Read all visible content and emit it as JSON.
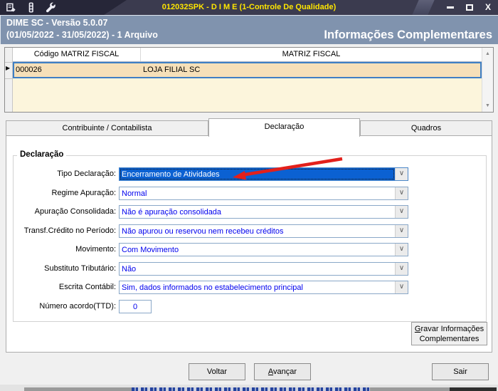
{
  "window": {
    "title": "012032SPK - D I M E (1-Controle De Qualidade)",
    "toolbar_icons": [
      "document-icon",
      "traffic-light-icon",
      "wrench-icon"
    ],
    "controls": {
      "minimize": "minimize",
      "maximize": "maximize",
      "close": "X"
    }
  },
  "header": {
    "version_line": "DIME SC - Versão 5.0.07",
    "period_line": "(01/05/2022 - 31/05/2022) - 1 Arquivo",
    "section_title": "Informações Complementares"
  },
  "grid": {
    "columns": [
      "Código MATRIZ FISCAL",
      "MATRIZ FISCAL"
    ],
    "rows": [
      [
        "000026",
        "LOJA FILIAL SC"
      ]
    ],
    "row_marker": "▶",
    "scroll_up": "▲",
    "scroll_down": "▼"
  },
  "tabs": [
    {
      "id": "contribuinte-contabilista",
      "label": "Contribuinte / Contabilista",
      "active": false
    },
    {
      "id": "declaracao",
      "label": "Declaração",
      "active": true
    },
    {
      "id": "quadros",
      "label": "Quadros",
      "active": false
    }
  ],
  "groupbox_title": "Declaração",
  "form": {
    "combo_chevron": "∨",
    "rows": [
      {
        "id": "tipo-declaracao",
        "label": "Tipo Declaração:",
        "value": "Encerramento de Atividades",
        "kind": "combo",
        "highlighted": true
      },
      {
        "id": "regime-apuracao",
        "label": "Regime Apuração:",
        "value": "Normal",
        "kind": "combo"
      },
      {
        "id": "apuracao-consolidada",
        "label": "Apuração Consolidada:",
        "value": "Não é apuração consolidada",
        "kind": "combo"
      },
      {
        "id": "transf-credito-periodo",
        "label": "Transf.Crédito no Período:",
        "value": "Não apurou ou reservou nem recebeu créditos",
        "kind": "combo"
      },
      {
        "id": "movimento",
        "label": "Movimento:",
        "value": "Com Movimento",
        "kind": "combo"
      },
      {
        "id": "substituto-tributario",
        "label": "Substituto Tributário:",
        "value": "Não",
        "kind": "combo"
      },
      {
        "id": "escrita-contabil",
        "label": "Escrita Contábil:",
        "value": "Sim, dados informados no estabelecimento principal",
        "kind": "combo"
      },
      {
        "id": "numero-acordo-ttd",
        "label": "Número acordo(TTD):",
        "value": "0",
        "kind": "input"
      }
    ]
  },
  "buttons": {
    "gravar": {
      "lines": [
        "Gravar Informações",
        "Complementares"
      ],
      "accel": "G"
    },
    "footer": [
      {
        "id": "voltar",
        "label": "Voltar"
      },
      {
        "id": "avancar",
        "label": "Avançar",
        "accel": "A"
      },
      {
        "id": "sair",
        "label": "Sair"
      }
    ]
  },
  "annotation": {
    "type": "arrow",
    "points_at": "tipo-declaracao-value",
    "color": "#E3201B"
  },
  "colors": {
    "titlebar_bg": "#3B3B4F",
    "titlebar_bg_dark": "#262638",
    "title_text": "#FFE600",
    "header_bg": "#8093AE",
    "header_text": "#FFFFFF",
    "body_bg": "#F0F0F0",
    "row_selected_bg": "#F6E0B9",
    "grid_empty_bg": "#FCF5DC",
    "selection_border": "#3F7FC4",
    "tab_border": "#ACACAC",
    "combo_text": "#0000EE",
    "combo_border": "#8AA8C8",
    "highlight_bg": "#0B61D2",
    "highlight_text": "#FFFFFF",
    "arrow_red": "#E3201B"
  }
}
